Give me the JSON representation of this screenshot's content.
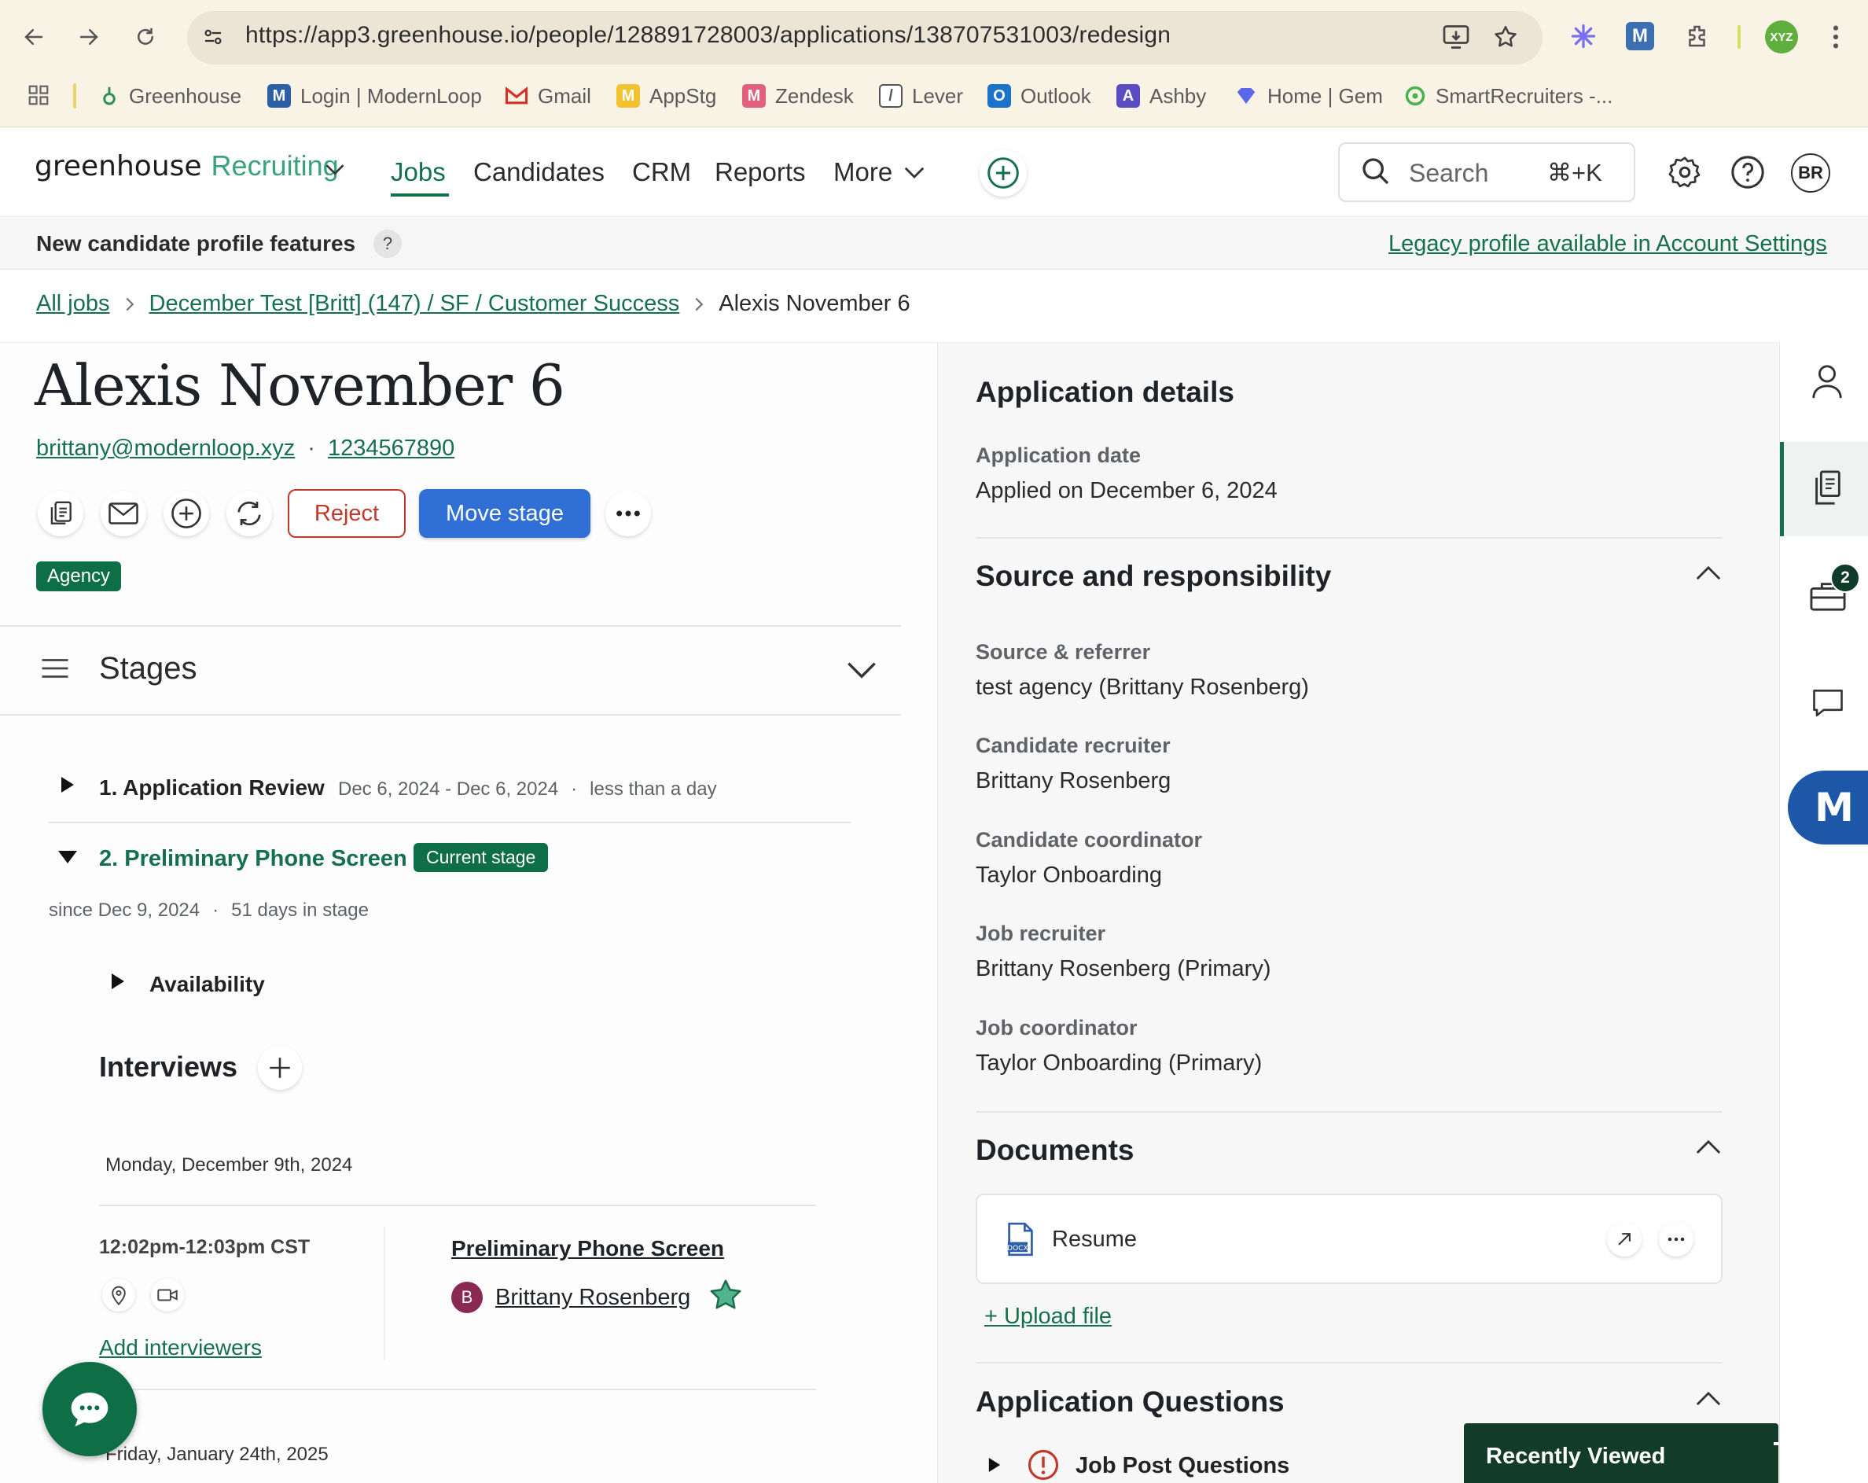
{
  "browser": {
    "url": "https://app3.greenhouse.io/people/128891728003/applications/138707531003/redesign",
    "profile": "XYZ",
    "bookmarks": [
      {
        "label": "Greenhouse",
        "color": "#2d8f5b",
        "letter": "g"
      },
      {
        "label": "Login | ModernLoop",
        "color": "#2d5fa6",
        "letter": "M"
      },
      {
        "label": "Gmail",
        "color": "#d93025",
        "letter": "M"
      },
      {
        "label": "AppStg",
        "color": "#f2c230",
        "letter": "M"
      },
      {
        "label": "Zendesk",
        "color": "#e0607e",
        "letter": "M"
      },
      {
        "label": "Lever",
        "color": "#555555",
        "letter": "/"
      },
      {
        "label": "Outlook",
        "color": "#1a73c9",
        "letter": "O"
      },
      {
        "label": "Ashby",
        "color": "#5b4cc4",
        "letter": "A"
      },
      {
        "label": "Home | Gem",
        "color": "#5a67e8",
        "letter": "◆"
      },
      {
        "label": "SmartRecruiters -...",
        "color": "#4caf50",
        "letter": "●"
      }
    ]
  },
  "app": {
    "logo_word": "greenhouse",
    "logo_product": "Recruiting",
    "nav": [
      "Jobs",
      "Candidates",
      "CRM",
      "Reports",
      "More"
    ],
    "search_placeholder": "Search",
    "search_shortcut": "⌘+K",
    "avatar_initials": "BR"
  },
  "banner": {
    "text": "New candidate profile features",
    "help": "?",
    "legacy_link": "Legacy profile available in Account Settings"
  },
  "breadcrumb": {
    "all_jobs": "All jobs",
    "job": "December Test [Britt] (147) / SF / Customer Success",
    "current": "Alexis November 6"
  },
  "candidate": {
    "name": "Alexis November 6",
    "email": "brittany@modernloop.xyz",
    "phone": "1234567890",
    "reject_label": "Reject",
    "move_stage_label": "Move stage",
    "tag": "Agency"
  },
  "stages": {
    "title": "Stages",
    "stage1": {
      "name": "1. Application Review",
      "dates": "Dec 6, 2024 - Dec 6, 2024",
      "duration": "less than a day"
    },
    "stage2": {
      "name": "2. Preliminary Phone Screen",
      "badge": "Current stage",
      "since": "since Dec 9, 2024",
      "days": "51 days in stage"
    },
    "availability": "Availability",
    "interviews_title": "Interviews",
    "interview_date_1": "Monday, December 9th, 2024",
    "interview_time": "12:02pm-12:03pm CST",
    "interview_name": "Preliminary Phone Screen",
    "interviewer_initial": "B",
    "interviewer_name": "Brittany Rosenberg",
    "add_interviewers": "Add interviewers",
    "interview_date_2": "Friday, January 24th, 2025"
  },
  "details": {
    "title": "Application details",
    "app_date_label": "Application date",
    "app_date_value": "Applied on December 6, 2024",
    "source_title": "Source and responsibility",
    "source_label": "Source & referrer",
    "source_value": "test agency (Brittany Rosenberg)",
    "cand_recruiter_label": "Candidate recruiter",
    "cand_recruiter_value": "Brittany Rosenberg",
    "cand_coord_label": "Candidate coordinator",
    "cand_coord_value": "Taylor Onboarding",
    "job_recruiter_label": "Job recruiter",
    "job_recruiter_value": "Brittany Rosenberg (Primary)",
    "job_coord_label": "Job coordinator",
    "job_coord_value": "Taylor Onboarding (Primary)",
    "documents_title": "Documents",
    "resume_label": "Resume",
    "upload_label": "+ Upload file",
    "questions_title": "Application Questions",
    "job_post_questions": "Job Post Questions"
  },
  "rail": {
    "jobs_badge": "2"
  },
  "recently_viewed": "Recently Viewed",
  "colors": {
    "brand_green": "#15704d",
    "primary_blue": "#2f6fd6",
    "reject_red": "#c0392b",
    "tag_green": "#0e6e45"
  }
}
